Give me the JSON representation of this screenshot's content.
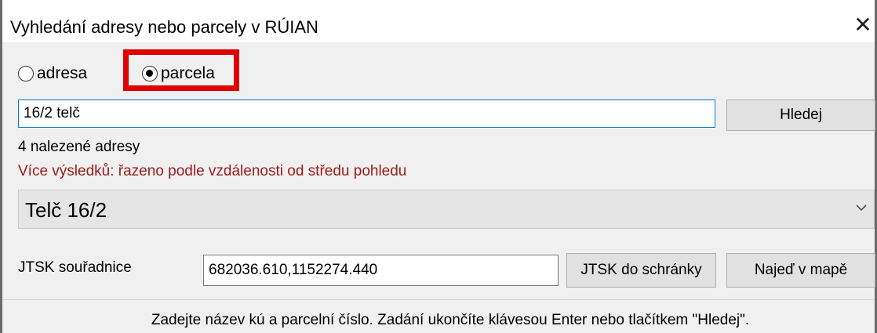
{
  "window": {
    "title": "Vyhledání adresy nebo parcely v RÚIAN",
    "close_glyph": "✕"
  },
  "mode": {
    "options": [
      {
        "label": "adresa",
        "checked": false
      },
      {
        "label": "parcela",
        "checked": true
      }
    ]
  },
  "search": {
    "value": "16/2 telč",
    "button_label": "Hledej"
  },
  "results": {
    "count_text": "4 nalezené adresy",
    "note": "Více výsledků: řazeno podle vzdálenosti od středu pohledu",
    "selected": "Telč 16/2"
  },
  "jtsk": {
    "label": "JTSK souřadnice",
    "value": "682036.610,1152274.440",
    "copy_button": "JTSK do schránky",
    "goto_button": "Najeď v mapě"
  },
  "status_text": "Zadejte název kú a parcelní číslo. Zadání ukončíte klávesou Enter nebo tlačítkem \"Hledej\".",
  "colors": {
    "highlight": "#e10000",
    "note_text": "#9b1b1b",
    "focus_border": "#0078d7"
  }
}
